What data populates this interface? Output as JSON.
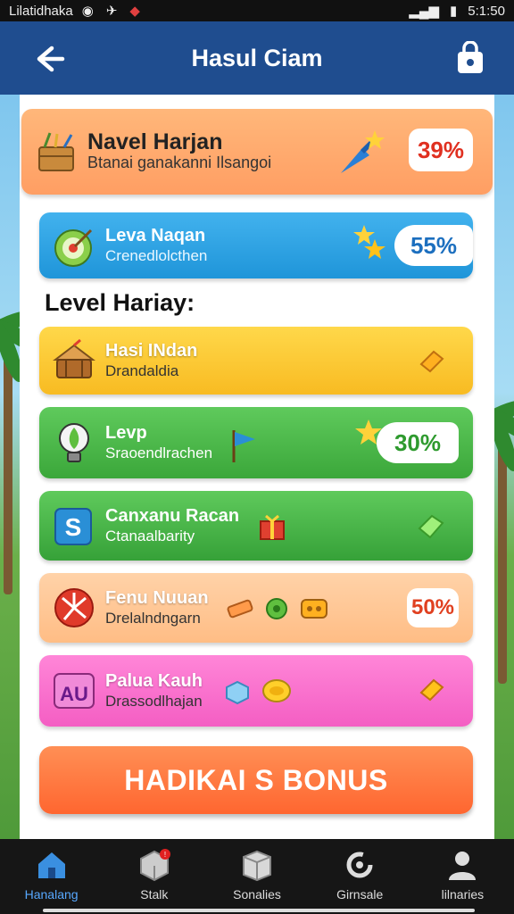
{
  "status_bar": {
    "carrier": "Lilatidhaka",
    "time": "5:1:50"
  },
  "header": {
    "title": "Hasul Ciam",
    "back_icon": "arrow-left-icon",
    "action_icon": "shopping-bag-icon"
  },
  "top_card": {
    "title": "Navel Harjan",
    "subtitle": "Btanai ganakanni Ilsangoi",
    "percent": "39%",
    "icon": "basket-icon"
  },
  "second_card": {
    "title": "Leva Naqan",
    "subtitle": "Crenedlolcthen",
    "percent": "55%",
    "icon": "target-icon"
  },
  "section_title": "Level Hariay:",
  "level_cards": [
    {
      "title": "Hasi INdan",
      "subtitle": "Drandaldia",
      "percent": "",
      "icon": "drum-icon",
      "color": "#f8bb22"
    },
    {
      "title": "Levp",
      "subtitle": "Sraoendlrachen",
      "percent": "30%",
      "icon": "lightbulb-icon",
      "color": "#3ba73a"
    },
    {
      "title": "Canxanu Racan",
      "subtitle": "Ctanaalbarity",
      "percent": "",
      "icon": "s-block-icon",
      "color": "#36a138"
    },
    {
      "title": "Fenu Nuuan",
      "subtitle": "Drelalndngarn",
      "percent": "50%",
      "icon": "pinwheel-icon",
      "color": "#ffbd85"
    },
    {
      "title": "Palua Kauh",
      "subtitle": "Drassodlhajan",
      "percent": "",
      "icon": "au-badge-icon",
      "color": "#f45ec3"
    }
  ],
  "bonus_button": "HADIKAI S BONUS",
  "nav": [
    {
      "label": "Hanalang",
      "icon": "home-icon",
      "active": true
    },
    {
      "label": "Stalk",
      "icon": "box-icon",
      "active": false
    },
    {
      "label": "Sonalies",
      "icon": "cube-icon",
      "active": false
    },
    {
      "label": "Girnsale",
      "icon": "refresh-icon",
      "active": false
    },
    {
      "label": "lilnaries",
      "icon": "user-icon",
      "active": false
    }
  ],
  "colors": {
    "header": "#1f4d8f",
    "accent_red": "#e03020",
    "accent_blue": "#1c6fbf",
    "accent_green": "#2e9a2e",
    "bonus": "#ff6630",
    "nav_active": "#57a8ff"
  }
}
